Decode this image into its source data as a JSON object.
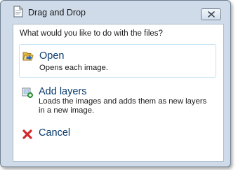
{
  "window": {
    "title": "Drag and Drop",
    "title_icon": "document-icon",
    "close_icon": "close-icon"
  },
  "dialog": {
    "prompt": "What would you like to do with the files?",
    "commands": [
      {
        "label": "Open",
        "description": "Opens each image.",
        "icon": "open-folder-icon"
      },
      {
        "label": "Add layers",
        "description": "Loads the images and adds them as new layers in a new image.",
        "icon": "add-layer-icon"
      },
      {
        "label": "Cancel",
        "description": "",
        "icon": "cancel-icon"
      }
    ]
  },
  "colors": {
    "frame": "#cfdbe8",
    "command_label": "#0a3c6e",
    "cancel_red": "#d42a2a",
    "hover_border": "#c4e2f4"
  }
}
